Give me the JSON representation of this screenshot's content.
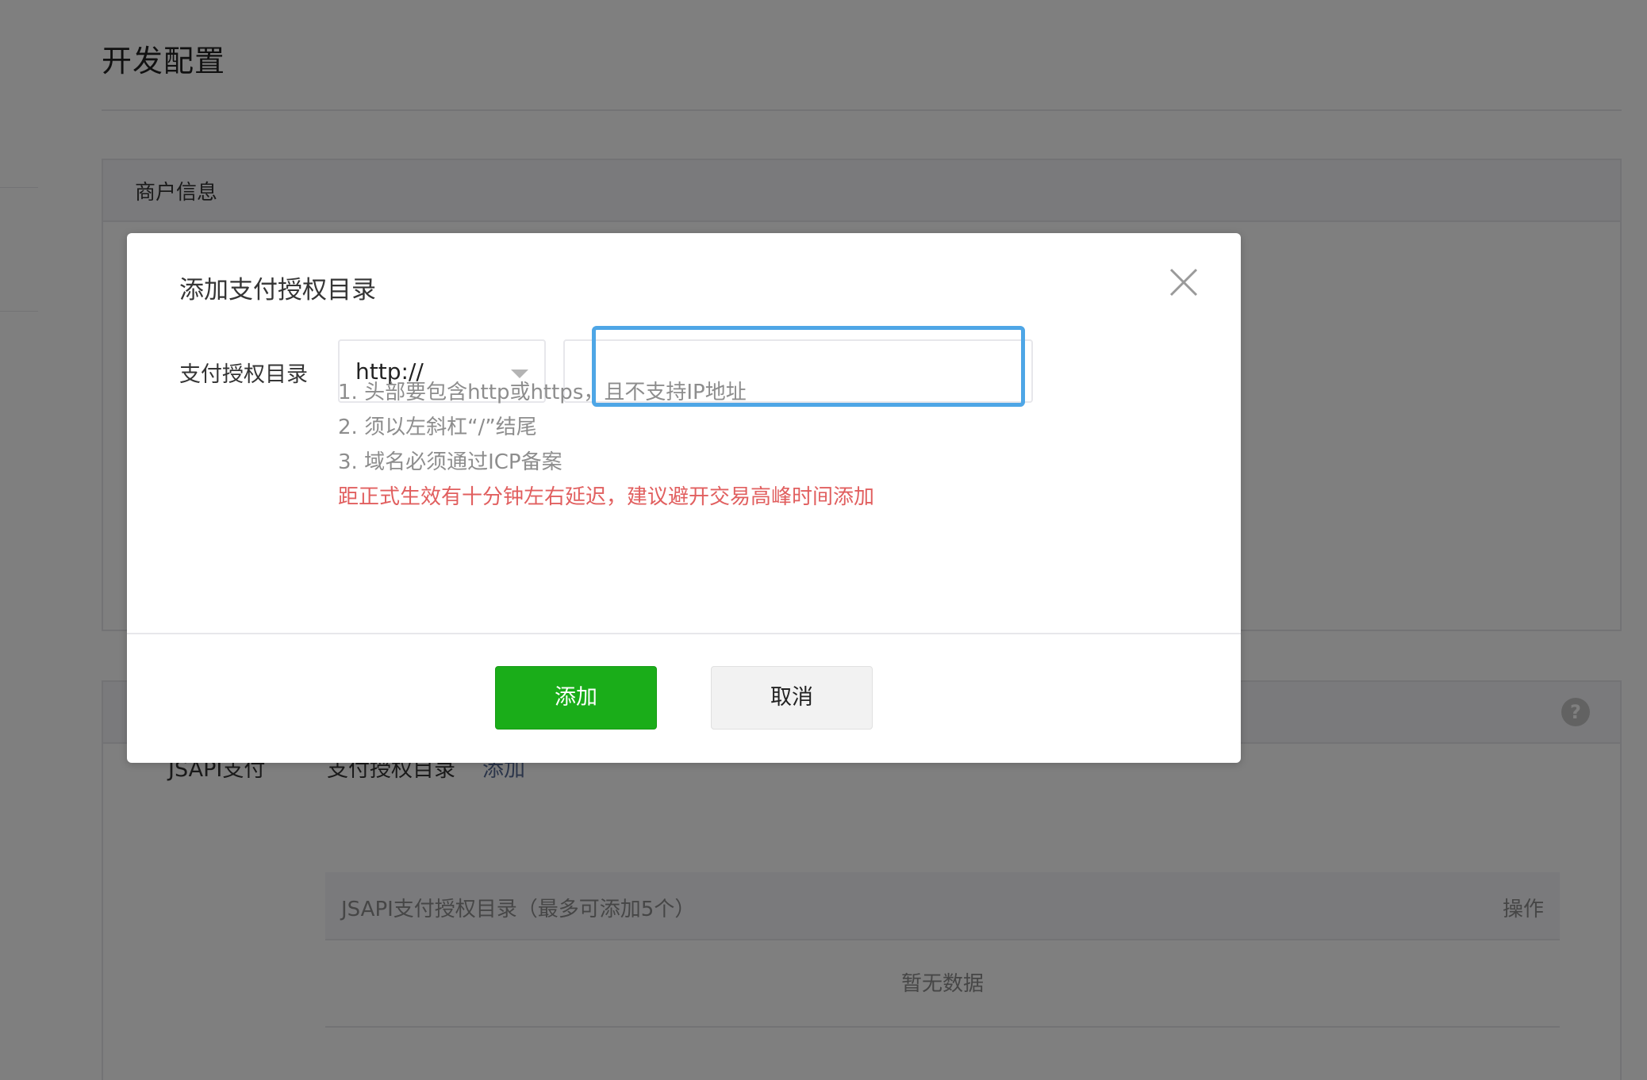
{
  "page": {
    "title": "开发配置",
    "merchant_panel": {
      "title": "商户信息"
    },
    "payment_panel": {
      "jsapi_label": "JSAPI支付",
      "dir_label": "支付授权目录",
      "add_link": "添加",
      "table": {
        "col_directory": "JSAPI支付授权目录（最多可添加5个）",
        "col_action": "操作",
        "empty_text": "暂无数据"
      },
      "help_icon": "?"
    }
  },
  "dialog": {
    "title": "添加支付授权目录",
    "field_label": "支付授权目录",
    "scheme": {
      "selected": "http://"
    },
    "domain_input": {
      "value": "",
      "placeholder": ""
    },
    "tips": [
      "1. 头部要包含http或https，且不支持IP地址",
      "2. 须以左斜杠“/”结尾",
      "3. 域名必须通过ICP备案"
    ],
    "warning": "距正式生效有十分钟左右延迟，建议避开交易高峰时间添加",
    "confirm_label": "添加",
    "cancel_label": "取消"
  },
  "colors": {
    "primary_green": "#1aad19",
    "link_blue": "#576b95",
    "warning_red": "#e15f5f",
    "focus_blue": "#4ea6e6"
  },
  "icons": [
    "close-icon",
    "chevron-down-icon",
    "help-icon"
  ]
}
